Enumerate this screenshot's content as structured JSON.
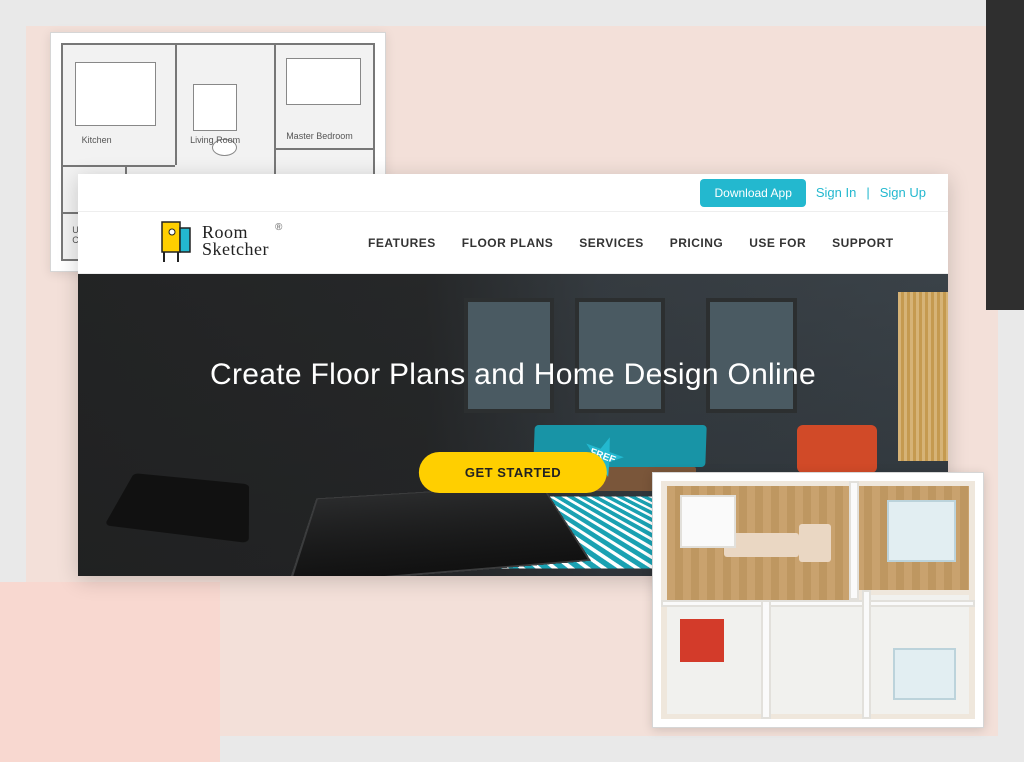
{
  "collage": {
    "plan2d_labels": {
      "kitchen": "Kitchen",
      "living": "Living Room",
      "master": "Master Bedroom",
      "utility": "Utility\nCloset"
    }
  },
  "site": {
    "topbar": {
      "download": "Download App",
      "signin": "Sign In",
      "signup": "Sign Up",
      "sep": "|"
    },
    "logo": {
      "line1": "Room",
      "line2": "Sketcher"
    },
    "nav": {
      "features": "FEATURES",
      "floorplans": "FLOOR PLANS",
      "services": "SERVICES",
      "pricing": "PRICING",
      "usefor": "USE FOR",
      "support": "SUPPORT"
    },
    "hero": {
      "title": "Create Floor Plans and Home Design Online",
      "cta": "GET STARTED",
      "free": "FREE"
    }
  }
}
